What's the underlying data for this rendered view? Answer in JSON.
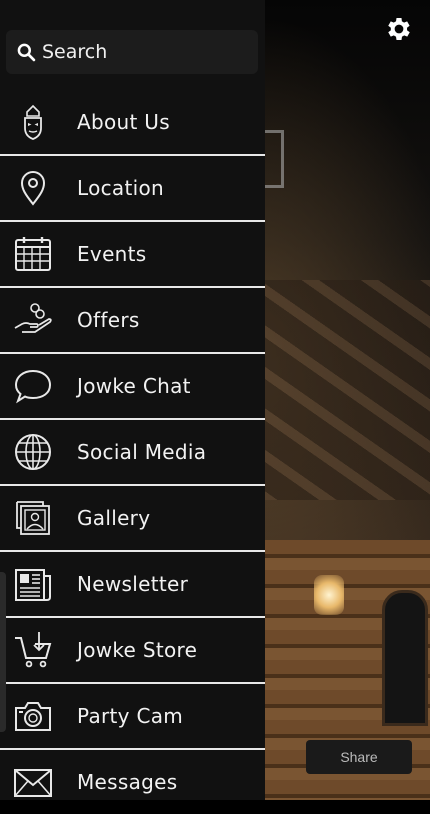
{
  "search": {
    "label": "Search",
    "icon": "search-icon"
  },
  "menu": {
    "items": [
      {
        "label": "About Us",
        "icon": "mask-logo-icon"
      },
      {
        "label": "Location",
        "icon": "map-pin-icon"
      },
      {
        "label": "Events",
        "icon": "calendar-icon"
      },
      {
        "label": "Offers",
        "icon": "hand-coins-icon"
      },
      {
        "label": "Jowke Chat",
        "icon": "chat-bubble-icon"
      },
      {
        "label": "Social Media",
        "icon": "globe-icon"
      },
      {
        "label": "Gallery",
        "icon": "photo-album-icon"
      },
      {
        "label": "Newsletter",
        "icon": "newspaper-icon"
      },
      {
        "label": "Jowke Store",
        "icon": "shopping-cart-icon"
      },
      {
        "label": "Party Cam",
        "icon": "camera-icon"
      },
      {
        "label": "Messages",
        "icon": "envelope-icon"
      }
    ]
  },
  "share": {
    "label": "Share"
  },
  "colors": {
    "drawer_bg": "#111111",
    "divider": "#e8e8e8",
    "text": "#f2f2f2"
  }
}
